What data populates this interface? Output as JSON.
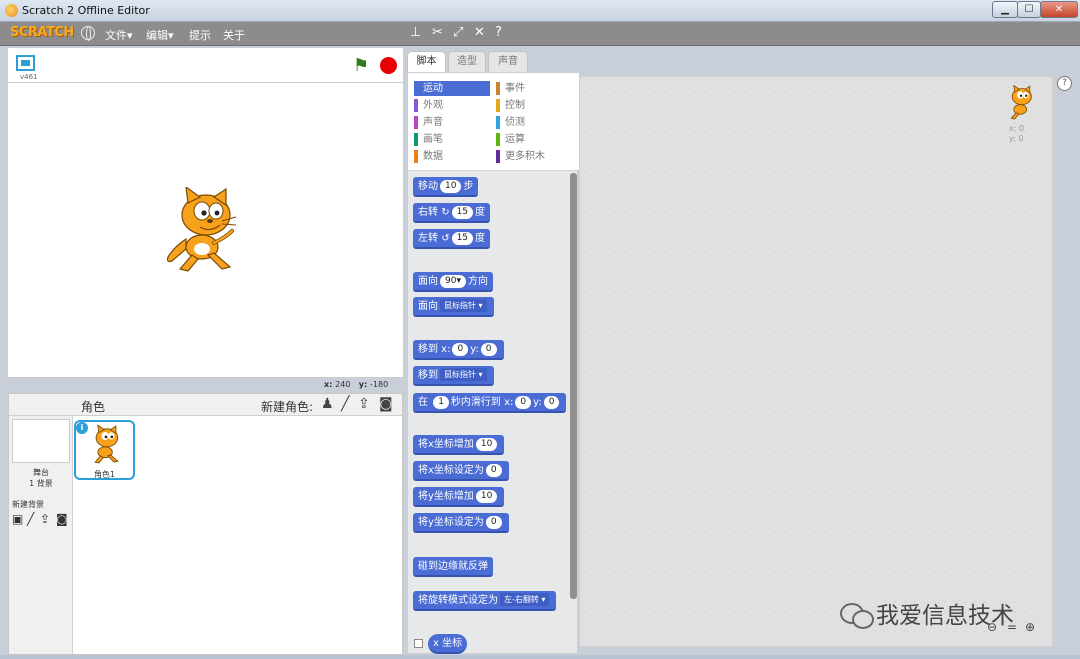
{
  "window": {
    "title": "Scratch 2 Offline Editor",
    "minimize": "▁",
    "maximize": "☐",
    "close": "✕"
  },
  "menubar": {
    "logo": "SCRATCH",
    "file": "文件▾",
    "edit": "编辑▾",
    "tips": "提示",
    "about": "关于"
  },
  "stage": {
    "version": "v461",
    "coords": {
      "x_label": "x:",
      "x_value": "240",
      "y_label": "y:",
      "y_value": "-180"
    }
  },
  "sprites": {
    "title": "角色",
    "new_sprite_label": "新建角色:",
    "stage_label": "舞台",
    "stage_backdrops": "1 背景",
    "new_backdrop_label": "新建背景",
    "items": [
      {
        "name": "角色1"
      }
    ]
  },
  "tabs": [
    {
      "label": "脚本"
    },
    {
      "label": "造型"
    },
    {
      "label": "声音"
    }
  ],
  "categories": [
    {
      "label": "运动",
      "color": "#4a6cd4"
    },
    {
      "label": "事件",
      "color": "#c88330"
    },
    {
      "label": "外观",
      "color": "#8a55d7"
    },
    {
      "label": "控制",
      "color": "#e1a91a"
    },
    {
      "label": "声音",
      "color": "#bb42c3"
    },
    {
      "label": "侦测",
      "color": "#2ca5e2"
    },
    {
      "label": "画笔",
      "color": "#0e9a6c"
    },
    {
      "label": "运算",
      "color": "#5cb712"
    },
    {
      "label": "数据",
      "color": "#ee7d16"
    },
    {
      "label": "更多积木",
      "color": "#632d99"
    }
  ],
  "blocks": {
    "move": {
      "pre": "移动",
      "val": "10",
      "post": "步"
    },
    "turn_right": {
      "pre": "右转",
      "icon": "↻",
      "val": "15",
      "post": "度"
    },
    "turn_left": {
      "pre": "左转",
      "icon": "↺",
      "val": "15",
      "post": "度"
    },
    "point_dir": {
      "pre": "面向",
      "val": "90▾",
      "post": "方向"
    },
    "point_towards": {
      "pre": "面向",
      "dd": "鼠标指针 ▾"
    },
    "goto_xy": {
      "pre": "移到 x:",
      "x": "0",
      "mid": "y:",
      "y": "0"
    },
    "goto": {
      "pre": "移到",
      "dd": "鼠标指针 ▾"
    },
    "glide": {
      "pre": "在",
      "secs": "1",
      "mid1": "秒内滑行到 x:",
      "x": "0",
      "mid2": "y:",
      "y": "0"
    },
    "change_x": {
      "pre": "将x坐标增加",
      "val": "10"
    },
    "set_x": {
      "pre": "将x坐标设定为",
      "val": "0"
    },
    "change_y": {
      "pre": "将y坐标增加",
      "val": "10"
    },
    "set_y": {
      "pre": "将y坐标设定为",
      "val": "0"
    },
    "bounce": {
      "label": "碰到边缘就反弹"
    },
    "rotation_style": {
      "pre": "将旋转模式设定为",
      "dd": "左-右翻转 ▾"
    },
    "x_position": {
      "label": "x 坐标"
    }
  },
  "script_area": {
    "x_readout": "x: 0",
    "y_readout": "y: 0",
    "help": "?",
    "zoom_out": "⊖",
    "zoom_reset": "=",
    "zoom_in": "⊕"
  },
  "watermark": {
    "text": "我爱信息技术"
  }
}
